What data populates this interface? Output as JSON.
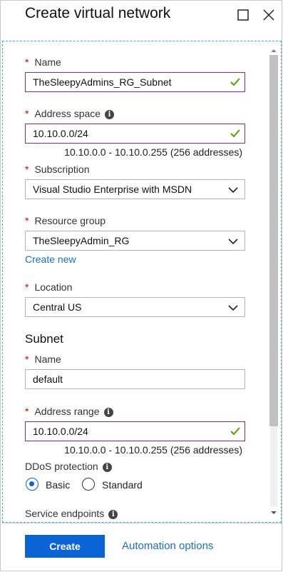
{
  "blade": {
    "title": "Create virtual network",
    "maximize_icon": "maximize-icon",
    "close_icon": "close-icon"
  },
  "form": {
    "name": {
      "label": "Name",
      "value": "TheSleepyAdmins_RG_Subnet",
      "valid": true
    },
    "address_space": {
      "label": "Address space",
      "value": "10.10.0.0/24",
      "hint": "10.10.0.0 - 10.10.0.255 (256 addresses)",
      "valid": true
    },
    "subscription": {
      "label": "Subscription",
      "selected": "Visual Studio Enterprise with MSDN"
    },
    "resource_group": {
      "label": "Resource group",
      "selected": "TheSleepyAdmin_RG",
      "create_new": "Create new"
    },
    "location": {
      "label": "Location",
      "selected": "Central US"
    },
    "subnet": {
      "heading": "Subnet",
      "name": {
        "label": "Name",
        "value": "default"
      },
      "address_range": {
        "label": "Address range",
        "value": "10.10.0.0/24",
        "hint": "10.10.0.0 - 10.10.0.255 (256 addresses)",
        "valid": true
      }
    },
    "ddos": {
      "label": "DDoS protection",
      "options": [
        "Basic",
        "Standard"
      ],
      "selected": "Basic"
    },
    "service_endpoints": {
      "label": "Service endpoints"
    }
  },
  "footer": {
    "create_label": "Create",
    "automation_label": "Automation options"
  },
  "colors": {
    "accent": "#0a64d6",
    "link": "#1a6fc4",
    "required": "#e00000",
    "valid_border": "#7a2f8f",
    "check": "#57a300"
  },
  "info_glyph": "i"
}
